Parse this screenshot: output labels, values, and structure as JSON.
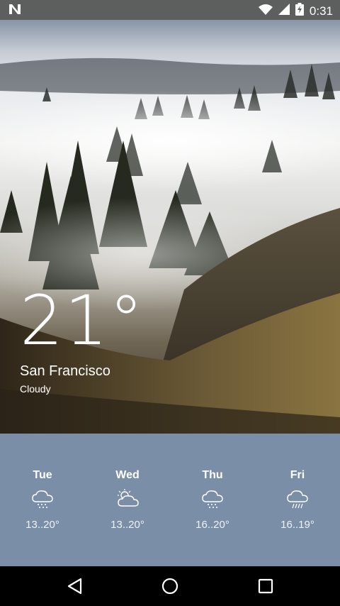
{
  "status_bar": {
    "time": "0:31",
    "icons": [
      "notification-n-icon",
      "wifi-icon",
      "signal-icon",
      "battery-charging-icon"
    ]
  },
  "current": {
    "temperature": "21°",
    "city": "San Francisco",
    "condition": "Cloudy"
  },
  "forecast": [
    {
      "day": "Tue",
      "range": "13..20°",
      "icon": "cloud-rain-icon"
    },
    {
      "day": "Wed",
      "range": "13..20°",
      "icon": "partly-cloudy-icon"
    },
    {
      "day": "Thu",
      "range": "16..20°",
      "icon": "cloud-rain-icon"
    },
    {
      "day": "Fri",
      "range": "16..19°",
      "icon": "cloud-drizzle-icon"
    }
  ],
  "nav_bar": {
    "buttons": [
      "back-icon",
      "home-icon",
      "recents-icon"
    ]
  },
  "colors": {
    "forecast_bg": "#7b8ea8",
    "status_bg": "#5d5f5f"
  }
}
